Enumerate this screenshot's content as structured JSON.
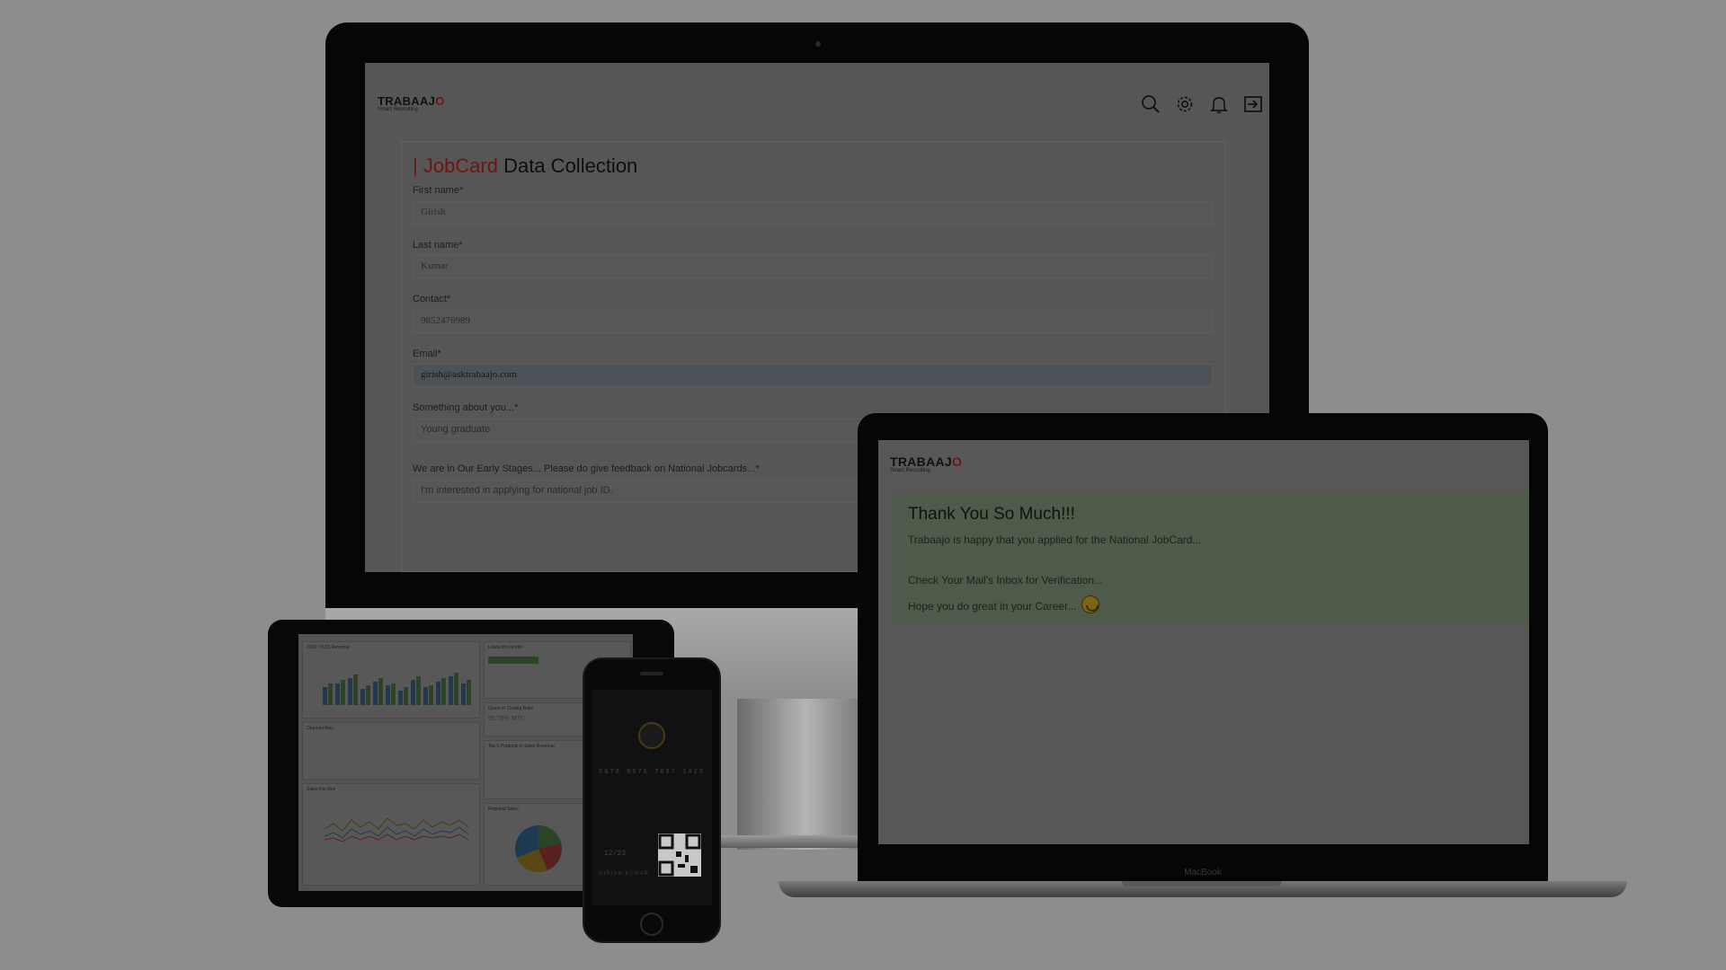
{
  "imac": {
    "brand": {
      "name_main": "TRABAAJ",
      "name_accent": "O",
      "tagline": "Smart Recruiting"
    },
    "nav": {
      "search_icon": "search-icon",
      "settings_icon": "gear-icon",
      "notifications_icon": "bell-icon",
      "logout_icon": "logout-icon"
    },
    "form": {
      "title_accent": "| JobCard",
      "title_rest": " Data Collection",
      "fields": [
        {
          "label": "First name*",
          "value": "Girish"
        },
        {
          "label": "Last name*",
          "value": "Kumar"
        },
        {
          "label": "Contact*",
          "value": "9852476989"
        },
        {
          "label": "Email*",
          "value": "girish@asktrabaajo.com"
        },
        {
          "label": "Something about you...*",
          "value": "Young graduate"
        },
        {
          "label": "We are in Our Early Stages... Please do give feedback on National Jobcards...*",
          "value": "I'm interested in applying for national job ID."
        }
      ]
    }
  },
  "macbook": {
    "brand": {
      "name_main": "TRABAAJ",
      "name_accent": "O",
      "tagline": "Smart Recruiting"
    },
    "thanks": {
      "title": "Thank You So Much!!!",
      "line1": "Trabaajo is happy that you applied for the National JobCard...",
      "line2": "Check Your Mail's Inbox for Verification...",
      "line3": "Hope you do great in your Career..."
    },
    "label": "MacBook"
  },
  "ipad": {
    "panel_titles": [
      "2016 / 2015 Revenue",
      "Leads this Month",
      "Quote to Closing Ratio",
      "Top 5 Products in Sales Revenue",
      "Opportunities",
      "Sales Per Rep",
      "Regional Sales"
    ],
    "ratio_value": "55.75% MTD"
  },
  "phone": {
    "card_number": "5678 8976 7897 3425",
    "expiry": "12/23",
    "holder": "GIRISH KUMAR"
  },
  "colors": {
    "accent": "#c0201e",
    "background": "#8d8d8d"
  }
}
